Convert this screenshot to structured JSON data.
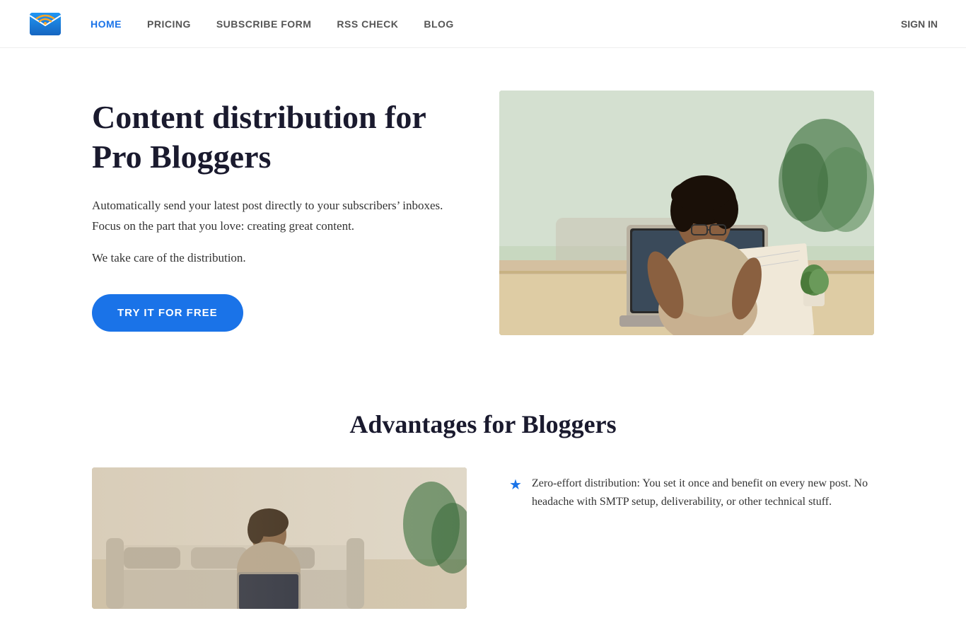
{
  "navbar": {
    "logo_alt": "Blog email distribution logo",
    "links": [
      {
        "label": "HOME",
        "active": true
      },
      {
        "label": "PRICING",
        "active": false
      },
      {
        "label": "SUBSCRIBE FORM",
        "active": false
      },
      {
        "label": "RSS CHECK",
        "active": false
      },
      {
        "label": "BLOG",
        "active": false
      }
    ],
    "signin_label": "SIGN IN"
  },
  "hero": {
    "title": "Content distribution for Pro Bloggers",
    "subtitle": "Automatically send your latest post directly to your subscribers’ inboxes. Focus on the part that you love: creating great content.",
    "tagline": "We take care of the distribution.",
    "cta_label": "TRY IT FOR FREE",
    "image_alt": "Woman working at laptop reading a notebook"
  },
  "advantages": {
    "title": "Advantages for Bloggers",
    "image_alt": "Person working on laptop at home",
    "items": [
      {
        "text": "Zero-effort distribution: You set it once and benefit on every new post. No headache with SMTP setup, deliverability, or other technical stuff."
      }
    ]
  }
}
